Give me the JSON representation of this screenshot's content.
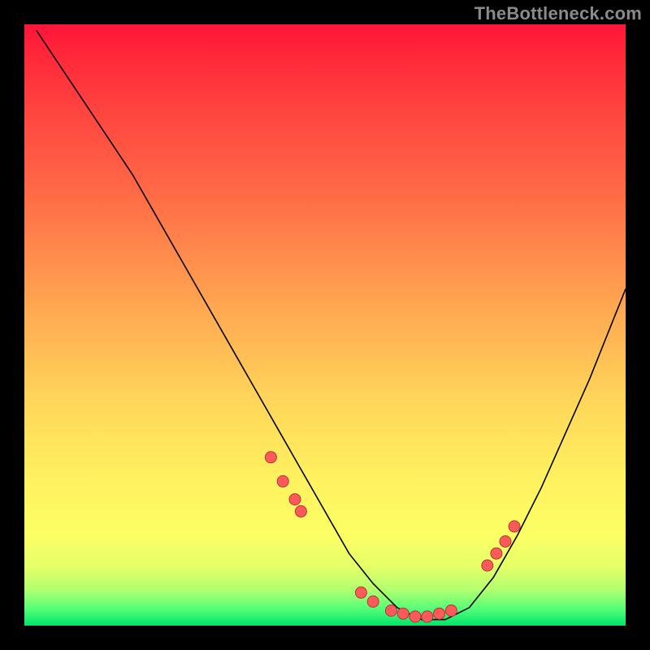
{
  "watermark": "TheBottleneck.com",
  "chart_data": {
    "type": "line",
    "title": "",
    "xlabel": "",
    "ylabel": "",
    "xlim": [
      0,
      100
    ],
    "ylim": [
      0,
      100
    ],
    "grid": false,
    "legend": false,
    "series": [
      {
        "name": "bottleneck-curve",
        "x": [
          2,
          6,
          10,
          14,
          18,
          22,
          26,
          30,
          34,
          38,
          42,
          46,
          50,
          54,
          58,
          62,
          66,
          70,
          74,
          78,
          82,
          86,
          90,
          94,
          98,
          100
        ],
        "y": [
          99,
          93,
          87,
          81,
          75,
          68,
          61,
          54,
          47,
          40,
          33,
          26,
          19,
          12,
          7,
          3,
          1,
          1,
          3,
          8,
          15,
          23,
          32,
          41,
          51,
          56
        ]
      }
    ],
    "markers": {
      "name": "highlight-dots",
      "x": [
        41,
        43,
        45,
        46,
        56,
        58,
        61,
        63,
        65,
        67,
        69,
        71,
        77,
        78.5,
        80,
        81.5
      ],
      "y": [
        28,
        24,
        21,
        19,
        5.5,
        4,
        2.5,
        2,
        1.5,
        1.5,
        2,
        2.5,
        10,
        12,
        14,
        16.5
      ]
    },
    "annotations": []
  },
  "style": {
    "curve_stroke": "#000000",
    "curve_width": 1.6,
    "dot_fill": "#ff5a5a",
    "dot_stroke": "#b03838",
    "dot_radius": 7
  }
}
